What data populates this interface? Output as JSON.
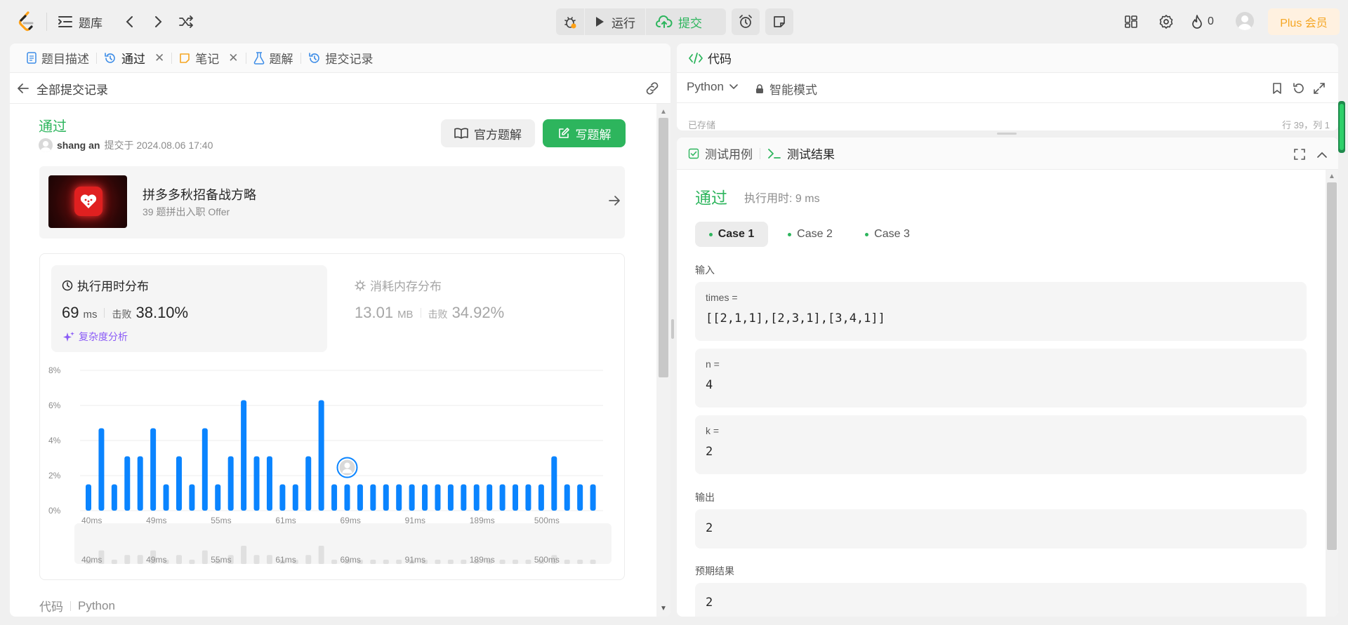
{
  "nav": {
    "problem_bank": "题库",
    "run_label": "运行",
    "submit_label": "提交",
    "streak_count": "0",
    "plus_label": "Plus 会员"
  },
  "left_panel": {
    "tabs": [
      {
        "label": "题目描述",
        "icon": "document-icon"
      },
      {
        "label": "通过",
        "icon": "history-icon",
        "closable": true
      },
      {
        "label": "笔记",
        "icon": "note-icon",
        "closable": true
      },
      {
        "label": "题解",
        "icon": "flask-icon"
      },
      {
        "label": "提交记录",
        "icon": "history-icon"
      }
    ],
    "back_label": "全部提交记录",
    "status": "通过",
    "submitter": "shang an",
    "submitted_at": "提交于 2024.08.06 17:40",
    "official_solution_btn": "官方题解",
    "write_solution_btn": "写题解",
    "promo": {
      "title": "拼多多秋招备战方略",
      "subtitle": "39 题拼出入职 Offer"
    },
    "runtime": {
      "title": "执行用时分布",
      "value": "69",
      "unit": "ms",
      "beats_label": "击败",
      "beats_value": "38.10%",
      "complexity_link": "复杂度分析"
    },
    "memory": {
      "title": "消耗内存分布",
      "value": "13.01",
      "unit": "MB",
      "beats_label": "击败",
      "beats_value": "34.92%"
    },
    "code_label": "代码",
    "code_lang": "Python"
  },
  "chart_data": {
    "type": "bar",
    "title": "",
    "xlabel": "",
    "ylabel": "",
    "ylim": [
      0,
      8
    ],
    "y_ticks": [
      "8%",
      "6%",
      "4%",
      "2%",
      "0%"
    ],
    "x_tick_labels": [
      "40ms",
      "49ms",
      "55ms",
      "61ms",
      "69ms",
      "91ms",
      "189ms",
      "500ms"
    ],
    "values": [
      1.5,
      4.7,
      1.5,
      3.1,
      3.1,
      4.7,
      1.5,
      3.1,
      1.5,
      4.7,
      1.5,
      3.1,
      6.3,
      3.1,
      3.1,
      1.5,
      1.5,
      3.1,
      6.3,
      1.5,
      1.5,
      1.5,
      1.5,
      1.5,
      1.5,
      1.5,
      1.5,
      1.5,
      1.5,
      1.5,
      1.5,
      1.5,
      1.5,
      1.5,
      1.5,
      1.5,
      3.1,
      1.5,
      1.5,
      1.5
    ],
    "user_bar_index": 20,
    "bar_color": "#0a84ff",
    "grid": true
  },
  "right_panel": {
    "code_title": "代码",
    "language": "Python",
    "mode": "智能模式",
    "saved": "已存储",
    "cursor_pos": "行 39，列 1",
    "test_tabs": [
      "测试用例",
      "测试结果"
    ],
    "result_status": "通过",
    "runtime_text": "执行用时: 9 ms",
    "cases": [
      "Case 1",
      "Case 2",
      "Case 3"
    ],
    "input_label": "输入",
    "inputs": [
      {
        "name": "times =",
        "value": "[[2,1,1],[2,3,1],[3,4,1]]"
      },
      {
        "name": "n =",
        "value": "4"
      },
      {
        "name": "k =",
        "value": "2"
      }
    ],
    "output_label": "输出",
    "output_value": "2",
    "expected_label": "预期结果",
    "expected_value": "2"
  },
  "colors": {
    "accent_green": "#2db55d",
    "plus_bg": "#fff1e0",
    "plus_text": "#f5a623",
    "chart_blue": "#0a84ff"
  }
}
